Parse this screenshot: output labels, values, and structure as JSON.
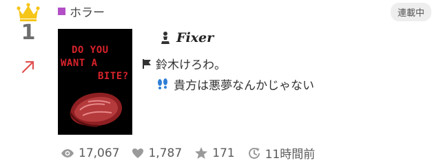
{
  "colors": {
    "genre": "#b24fc7",
    "crown": "#f5c518",
    "trend": "#e05050",
    "coverText": "#d8232b"
  },
  "rank": {
    "number": "1",
    "trend_icon": "trend-up-arrow-icon"
  },
  "genre": {
    "label": "ホラー"
  },
  "status": {
    "label": "連載中"
  },
  "cover": {
    "line1": "DO YOU",
    "line2": "WANT A",
    "line3": "BITE?"
  },
  "work": {
    "title": "Fixer",
    "author": "鈴木けろわ。",
    "tagline": "貴方は悪夢なんかじゃない"
  },
  "stats": {
    "views": "17,067",
    "likes": "1,787",
    "stars": "171",
    "updated": "11時間前"
  }
}
